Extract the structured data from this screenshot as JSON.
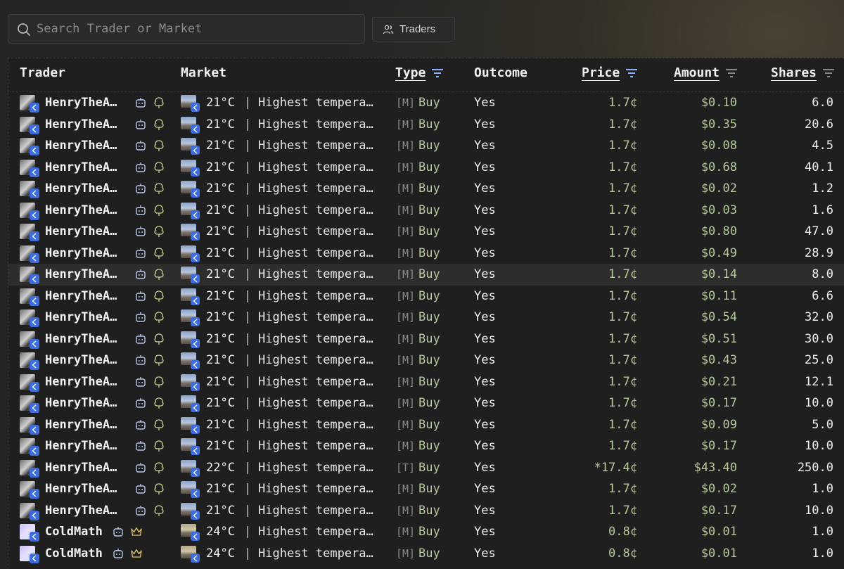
{
  "search": {
    "placeholder": "Search Trader or Market"
  },
  "toolbar": {
    "traders_label": "Traders"
  },
  "columns": {
    "trader": "Trader",
    "market": "Market",
    "type": "Type",
    "outcome": "Outcome",
    "price": "Price",
    "amount": "Amount",
    "shares": "Shares"
  },
  "colors": {
    "accent_green": "#b5c99a",
    "badge_blue": "#3d6be0",
    "filter_active": "#8fb0ff"
  },
  "rows": [
    {
      "trader": "HenryTheA…",
      "temp": "21°C",
      "market": "Highest tempera…",
      "tag": "[M]",
      "type": "Buy",
      "outcome": "Yes",
      "price": "1.7¢",
      "amount": "$0.10",
      "shares": "6.0",
      "icon2": "tree"
    },
    {
      "trader": "HenryTheA…",
      "temp": "21°C",
      "market": "Highest tempera…",
      "tag": "[M]",
      "type": "Buy",
      "outcome": "Yes",
      "price": "1.7¢",
      "amount": "$0.35",
      "shares": "20.6",
      "icon2": "tree"
    },
    {
      "trader": "HenryTheA…",
      "temp": "21°C",
      "market": "Highest tempera…",
      "tag": "[M]",
      "type": "Buy",
      "outcome": "Yes",
      "price": "1.7¢",
      "amount": "$0.08",
      "shares": "4.5",
      "icon2": "tree"
    },
    {
      "trader": "HenryTheA…",
      "temp": "21°C",
      "market": "Highest tempera…",
      "tag": "[M]",
      "type": "Buy",
      "outcome": "Yes",
      "price": "1.7¢",
      "amount": "$0.68",
      "shares": "40.1",
      "icon2": "tree"
    },
    {
      "trader": "HenryTheA…",
      "temp": "21°C",
      "market": "Highest tempera…",
      "tag": "[M]",
      "type": "Buy",
      "outcome": "Yes",
      "price": "1.7¢",
      "amount": "$0.02",
      "shares": "1.2",
      "icon2": "tree"
    },
    {
      "trader": "HenryTheA…",
      "temp": "21°C",
      "market": "Highest tempera…",
      "tag": "[M]",
      "type": "Buy",
      "outcome": "Yes",
      "price": "1.7¢",
      "amount": "$0.03",
      "shares": "1.6",
      "icon2": "tree"
    },
    {
      "trader": "HenryTheA…",
      "temp": "21°C",
      "market": "Highest tempera…",
      "tag": "[M]",
      "type": "Buy",
      "outcome": "Yes",
      "price": "1.7¢",
      "amount": "$0.80",
      "shares": "47.0",
      "icon2": "tree"
    },
    {
      "trader": "HenryTheA…",
      "temp": "21°C",
      "market": "Highest tempera…",
      "tag": "[M]",
      "type": "Buy",
      "outcome": "Yes",
      "price": "1.7¢",
      "amount": "$0.49",
      "shares": "28.9",
      "icon2": "tree"
    },
    {
      "trader": "HenryTheA…",
      "temp": "21°C",
      "market": "Highest tempera…",
      "tag": "[M]",
      "type": "Buy",
      "outcome": "Yes",
      "price": "1.7¢",
      "amount": "$0.14",
      "shares": "8.0",
      "icon2": "tree"
    },
    {
      "trader": "HenryTheA…",
      "temp": "21°C",
      "market": "Highest tempera…",
      "tag": "[M]",
      "type": "Buy",
      "outcome": "Yes",
      "price": "1.7¢",
      "amount": "$0.11",
      "shares": "6.6",
      "icon2": "tree"
    },
    {
      "trader": "HenryTheA…",
      "temp": "21°C",
      "market": "Highest tempera…",
      "tag": "[M]",
      "type": "Buy",
      "outcome": "Yes",
      "price": "1.7¢",
      "amount": "$0.54",
      "shares": "32.0",
      "icon2": "tree"
    },
    {
      "trader": "HenryTheA…",
      "temp": "21°C",
      "market": "Highest tempera…",
      "tag": "[M]",
      "type": "Buy",
      "outcome": "Yes",
      "price": "1.7¢",
      "amount": "$0.51",
      "shares": "30.0",
      "icon2": "tree"
    },
    {
      "trader": "HenryTheA…",
      "temp": "21°C",
      "market": "Highest tempera…",
      "tag": "[M]",
      "type": "Buy",
      "outcome": "Yes",
      "price": "1.7¢",
      "amount": "$0.43",
      "shares": "25.0",
      "icon2": "tree"
    },
    {
      "trader": "HenryTheA…",
      "temp": "21°C",
      "market": "Highest tempera…",
      "tag": "[M]",
      "type": "Buy",
      "outcome": "Yes",
      "price": "1.7¢",
      "amount": "$0.21",
      "shares": "12.1",
      "icon2": "tree"
    },
    {
      "trader": "HenryTheA…",
      "temp": "21°C",
      "market": "Highest tempera…",
      "tag": "[M]",
      "type": "Buy",
      "outcome": "Yes",
      "price": "1.7¢",
      "amount": "$0.17",
      "shares": "10.0",
      "icon2": "tree"
    },
    {
      "trader": "HenryTheA…",
      "temp": "21°C",
      "market": "Highest tempera…",
      "tag": "[M]",
      "type": "Buy",
      "outcome": "Yes",
      "price": "1.7¢",
      "amount": "$0.09",
      "shares": "5.0",
      "icon2": "tree"
    },
    {
      "trader": "HenryTheA…",
      "temp": "21°C",
      "market": "Highest tempera…",
      "tag": "[M]",
      "type": "Buy",
      "outcome": "Yes",
      "price": "1.7¢",
      "amount": "$0.17",
      "shares": "10.0",
      "icon2": "tree"
    },
    {
      "trader": "HenryTheA…",
      "temp": "22°C",
      "market": "Highest tempera…",
      "tag": "[T]",
      "type": "Buy",
      "outcome": "Yes",
      "price": "*17.4¢",
      "amount": "$43.40",
      "shares": "250.0",
      "icon2": "tree"
    },
    {
      "trader": "HenryTheA…",
      "temp": "21°C",
      "market": "Highest tempera…",
      "tag": "[M]",
      "type": "Buy",
      "outcome": "Yes",
      "price": "1.7¢",
      "amount": "$0.02",
      "shares": "1.0",
      "icon2": "tree"
    },
    {
      "trader": "HenryTheA…",
      "temp": "21°C",
      "market": "Highest tempera…",
      "tag": "[M]",
      "type": "Buy",
      "outcome": "Yes",
      "price": "1.7¢",
      "amount": "$0.17",
      "shares": "10.0",
      "icon2": "tree"
    },
    {
      "trader": "ColdMath",
      "temp": "24°C",
      "market": "Highest tempera…",
      "tag": "[M]",
      "type": "Buy",
      "outcome": "Yes",
      "price": "0.8¢",
      "amount": "$0.01",
      "shares": "1.0",
      "icon2": "crown"
    },
    {
      "trader": "ColdMath",
      "temp": "24°C",
      "market": "Highest tempera…",
      "tag": "[M]",
      "type": "Buy",
      "outcome": "Yes",
      "price": "0.8¢",
      "amount": "$0.01",
      "shares": "1.0",
      "icon2": "crown"
    }
  ]
}
